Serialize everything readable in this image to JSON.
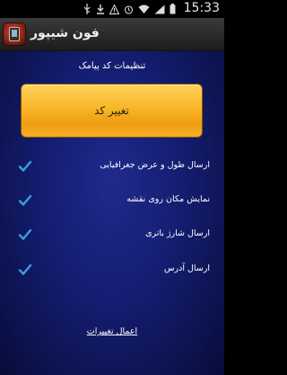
{
  "status_bar": {
    "time": "15:33",
    "icons": [
      "usb-icon",
      "download-icon",
      "warning-icon",
      "alarm-icon",
      "wifi-icon",
      "signal-icon",
      "battery-icon"
    ]
  },
  "action_bar": {
    "title": "فون شیپور",
    "icon": "app-phone-icon"
  },
  "settings": {
    "section_title": "تنظیمات کد پیامک",
    "change_button": "تغییر کد",
    "options": [
      {
        "label": "ارسال طول و عرض جغرافیایی",
        "checked": true
      },
      {
        "label": "نمایش مکان روی نقشه",
        "checked": true
      },
      {
        "label": "ارسال شارژ باتری",
        "checked": true
      },
      {
        "label": "ارسال آدرس",
        "checked": true
      }
    ],
    "apply_label": "اعمال تغییرات"
  },
  "colors": {
    "background": "#141d70",
    "button": "#f9b62a",
    "check": "#3aa0e0"
  }
}
